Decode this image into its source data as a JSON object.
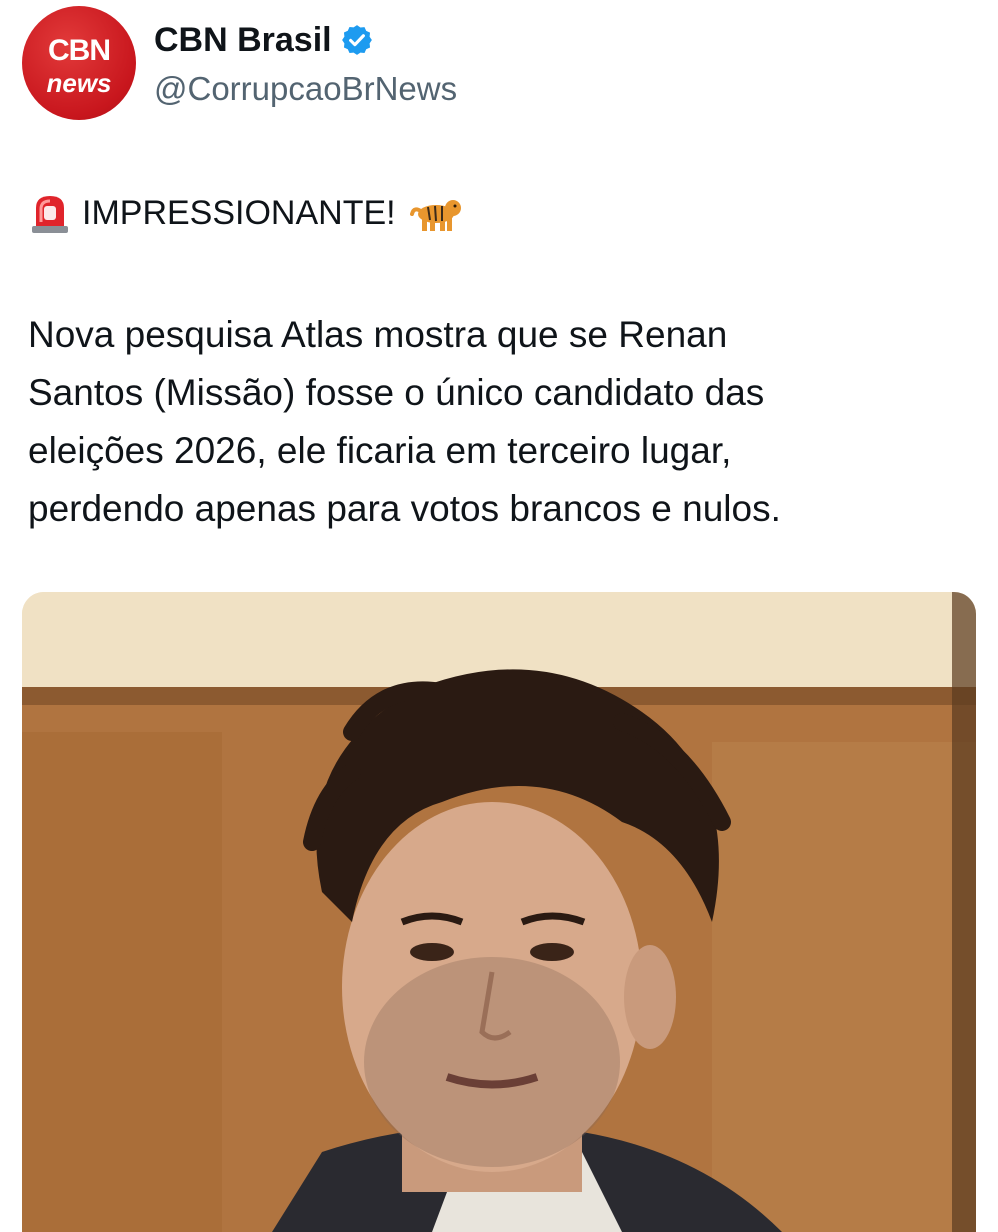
{
  "author": {
    "avatar": {
      "line1": "CBN",
      "line2": "news"
    },
    "display_name": "CBN Brasil",
    "handle": "@CorrupcaoBrNews",
    "verified_icon": "verified-badge-icon"
  },
  "tweet": {
    "headline": "IMPRESSIONANTE!",
    "headline_icons": [
      "rotating-light-icon",
      "tiger-icon"
    ],
    "body_lines": [
      "Nova pesquisa Atlas mostra que se Renan",
      "Santos (Missão) fosse o único candidato das",
      "eleições 2026, ele ficaria em terceiro lugar,",
      "perdendo apenas para votos brancos e nulos."
    ]
  },
  "media": {
    "type": "photo"
  },
  "colors": {
    "brand_red": "#c8161d",
    "verified_blue": "#1d9bf0",
    "handle_gray": "#536471"
  }
}
